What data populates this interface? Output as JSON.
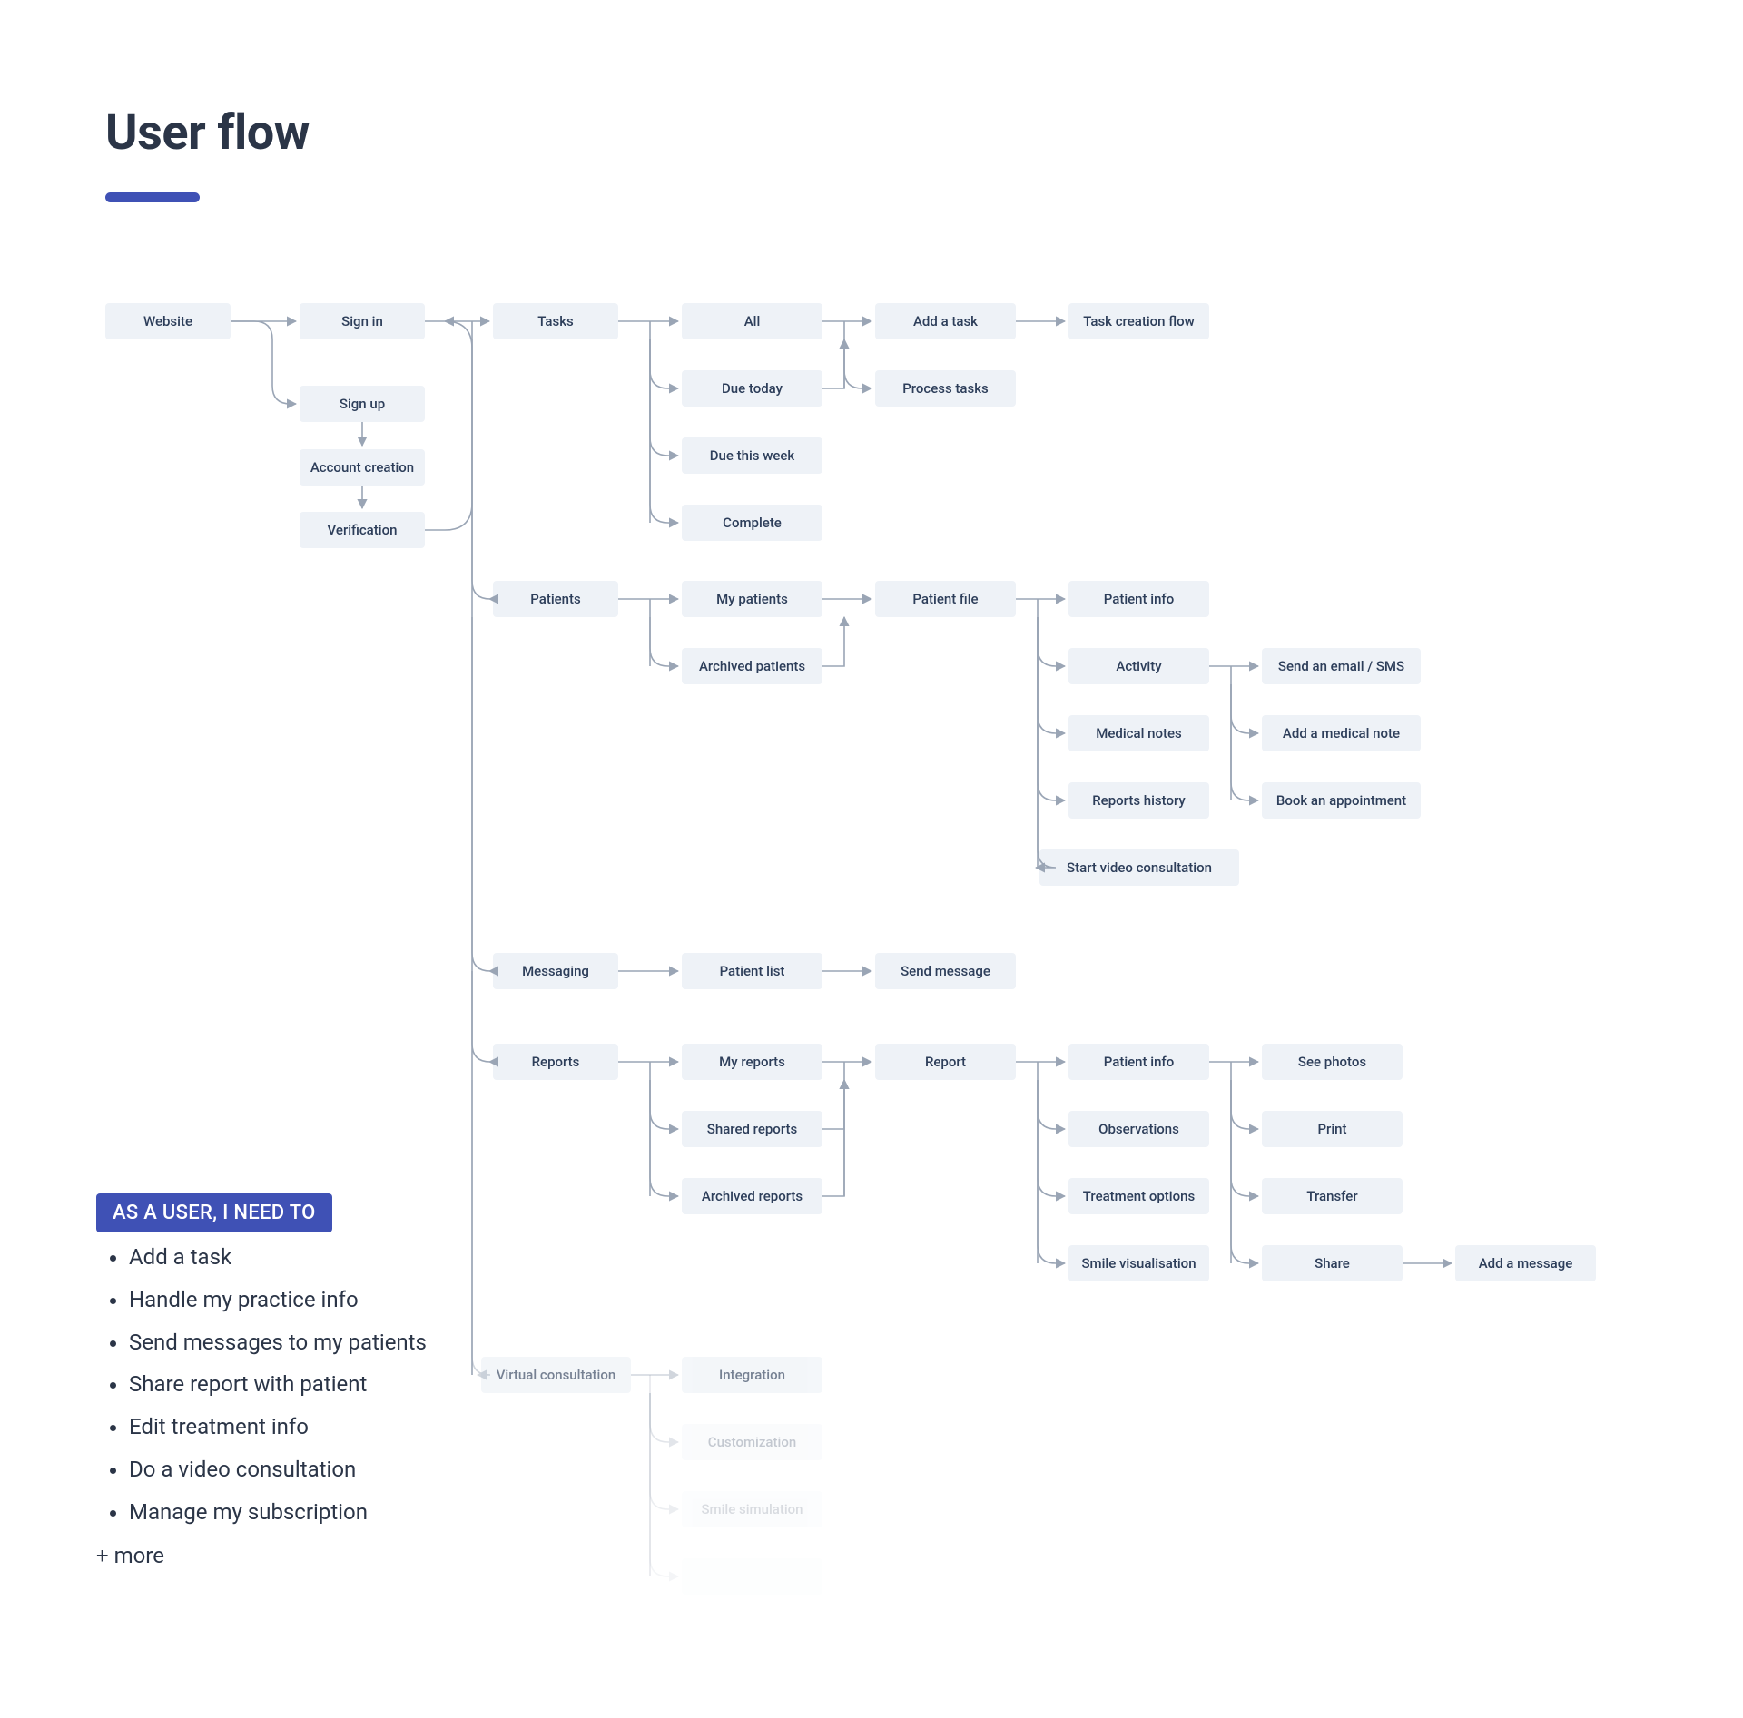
{
  "title": "User flow",
  "needs": {
    "heading": "AS A USER, I NEED TO",
    "items": [
      "Add a task",
      "Handle my practice info",
      "Send messages to my patients",
      "Share report with patient",
      "Edit treatment info",
      "Do a video consultation",
      "Manage my subscription"
    ],
    "more": "+ more"
  },
  "nodes": {
    "website": "Website",
    "signin": "Sign in",
    "signup": "Sign up",
    "account_creation": "Account creation",
    "verification": "Verification",
    "tasks": "Tasks",
    "tasks_all": "All",
    "tasks_due_today": "Due today",
    "tasks_due_week": "Due this week",
    "tasks_complete": "Complete",
    "task_add": "Add a task",
    "task_process": "Process tasks",
    "task_creation_flow": "Task creation flow",
    "patients": "Patients",
    "my_patients": "My patients",
    "archived_patients": "Archived patients",
    "patient_file": "Patient file",
    "patient_info": "Patient info",
    "activity": "Activity",
    "medical_notes": "Medical notes",
    "reports_history": "Reports history",
    "start_video": "Start video consultation",
    "send_email_sms": "Send an email / SMS",
    "add_medical_note": "Add a medical note",
    "book_appt": "Book an appointment",
    "messaging": "Messaging",
    "patient_list": "Patient list",
    "send_message": "Send message",
    "reports": "Reports",
    "my_reports": "My reports",
    "shared_reports": "Shared reports",
    "archived_reports": "Archived reports",
    "report": "Report",
    "rpt_patient_info": "Patient info",
    "observations": "Observations",
    "treatment_options": "Treatment options",
    "smile_vis": "Smile visualisation",
    "see_photos": "See photos",
    "print": "Print",
    "transfer": "Transfer",
    "share": "Share",
    "add_message": "Add a message",
    "virtual_consult": "Virtual consultation",
    "integration": "Integration",
    "customization": "Customization",
    "smile_sim": "Smile simulation",
    "vc_more": ""
  }
}
